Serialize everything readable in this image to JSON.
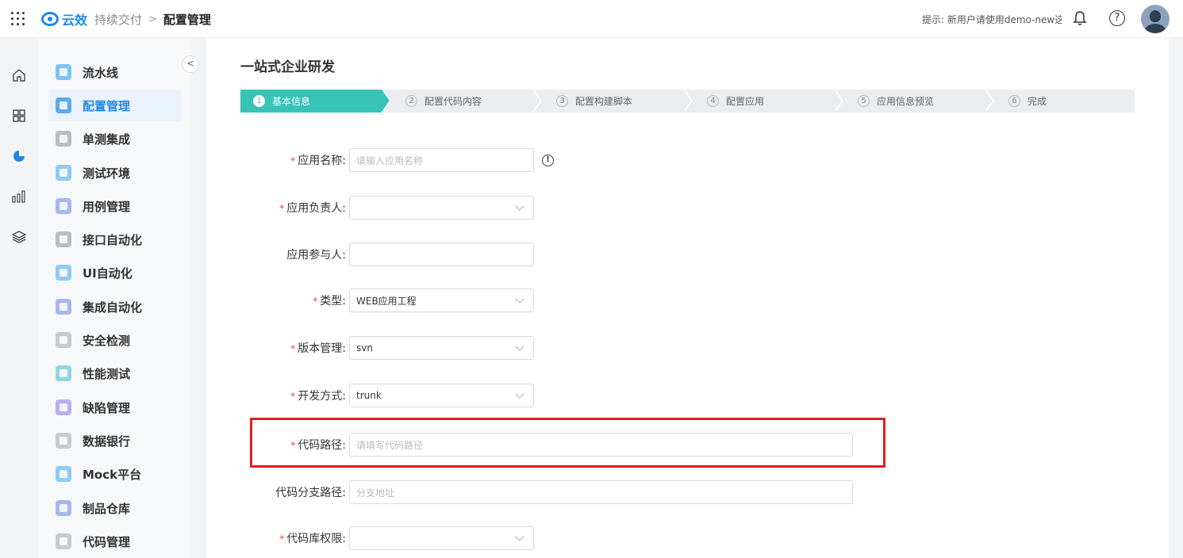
{
  "header": {
    "brand": "云效",
    "breadcrumb_parent": "持续交付",
    "breadcrumb_sep": ">",
    "breadcrumb_current": "配置管理",
    "tip": "提示: 新用户请使用demo-new这",
    "help_glyph": "?"
  },
  "sidebar": {
    "collapse_glyph": "<",
    "items": [
      {
        "label": "流水线",
        "color": "#7cc3f5"
      },
      {
        "label": "配置管理",
        "color": "#5aa9ef"
      },
      {
        "label": "单测集成",
        "color": "#b8bcc4"
      },
      {
        "label": "测试环境",
        "color": "#8fcbf5"
      },
      {
        "label": "用例管理",
        "color": "#a9b6f0"
      },
      {
        "label": "接口自动化",
        "color": "#b8bcc4"
      },
      {
        "label": "UI自动化",
        "color": "#8fcbf5"
      },
      {
        "label": "集成自动化",
        "color": "#a9b6f0"
      },
      {
        "label": "安全检测",
        "color": "#c6c9cf"
      },
      {
        "label": "性能测试",
        "color": "#8fd6e0"
      },
      {
        "label": "缺陷管理",
        "color": "#b9b1ef"
      },
      {
        "label": "数据银行",
        "color": "#c6c9cf"
      },
      {
        "label": "Mock平台",
        "color": "#8fcbf5"
      },
      {
        "label": "制品仓库",
        "color": "#a9b6f0"
      },
      {
        "label": "代码管理",
        "color": "#c6c9cf"
      }
    ]
  },
  "main": {
    "title": "一站式企业研发",
    "steps": [
      {
        "num": "1",
        "label": "基本信息"
      },
      {
        "num": "2",
        "label": "配置代码内容"
      },
      {
        "num": "3",
        "label": "配置构建脚本"
      },
      {
        "num": "4",
        "label": "配置应用"
      },
      {
        "num": "5",
        "label": "应用信息预览"
      },
      {
        "num": "6",
        "label": "完成"
      }
    ],
    "form": {
      "required_mark": "*",
      "app_name": {
        "label": "应用名称:",
        "placeholder": "请输入应用名称"
      },
      "owner": {
        "label": "应用负责人:",
        "value": ""
      },
      "participants": {
        "label": "应用参与人:",
        "value": ""
      },
      "type": {
        "label": "类型:",
        "value": "WEB应用工程"
      },
      "vcs": {
        "label": "版本管理:",
        "value": "svn"
      },
      "dev_mode": {
        "label": "开发方式:",
        "value": "trunk"
      },
      "code_path": {
        "label": "代码路径:",
        "placeholder": "请填写代码路径"
      },
      "branch_path": {
        "label": "代码分支路径:",
        "placeholder": "分支地址"
      },
      "repo_permission": {
        "label": "代码库权限:",
        "value": ""
      }
    },
    "info_glyph": "!",
    "highlight_color": "#e01e24"
  }
}
